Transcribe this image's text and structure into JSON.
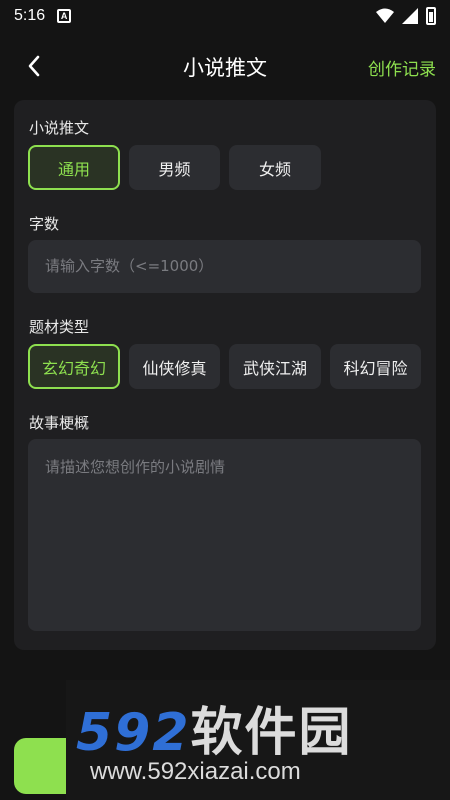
{
  "status_bar": {
    "time": "5:16",
    "a_icon_letter": "A"
  },
  "header": {
    "title": "小说推文",
    "history_label": "创作记录"
  },
  "sections": {
    "category": {
      "label": "小说推文",
      "options": [
        "通用",
        "男频",
        "女频"
      ],
      "selected": "通用"
    },
    "word_count": {
      "label": "字数",
      "placeholder": "请输入字数（<=1000）"
    },
    "genre": {
      "label": "题材类型",
      "options": [
        "玄幻奇幻",
        "仙侠修真",
        "武侠江湖",
        "科幻冒险"
      ],
      "selected": "玄幻奇幻"
    },
    "synopsis": {
      "label": "故事梗概",
      "placeholder": "请描述您想创作的小说剧情"
    }
  },
  "watermark": {
    "brand_number": "592",
    "brand_text": "软件园",
    "url": "www.592xiazai.com"
  },
  "colors": {
    "accent": "#8ee04f",
    "background": "#141414",
    "card": "#1f1f21",
    "control": "#2c2d31",
    "watermark_blue": "#2f6fd6"
  }
}
